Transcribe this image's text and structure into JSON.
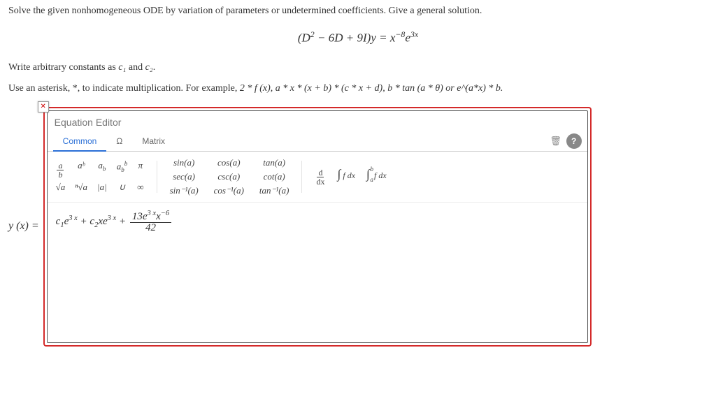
{
  "problem": {
    "line1": "Solve the given nonhomogeneous ODE by variation of parameters or undetermined coefficients. Give a general solution.",
    "display_equation": "(D² − 6D + 9I)y = x⁻⁸e³ˣ",
    "line2_prefix": "Write arbitrary constants as ",
    "const1": "c₁",
    "const_and": " and ",
    "const2": "c₂",
    "line3_prefix": "Use an asterisk, *, to indicate multiplication. For example, ",
    "line3_examples": "2 * f (x), a * x * (x + b) * (c * x + d), b * tan (a * θ) or e^(a*x) * b."
  },
  "lhs": "y (x) =",
  "editor": {
    "title": "Equation Editor",
    "close_glyph": "✕",
    "tabs": {
      "common": "Common",
      "omega": "Ω",
      "matrix": "Matrix"
    },
    "toolbar": {
      "trash_glyph": "🗑",
      "help_glyph": "?"
    },
    "palette": {
      "g1": {
        "frac_a": "a",
        "frac_b": "b",
        "ab": "aᵇ",
        "a_sub": "a_b",
        "a_sub_sup": "aᵇ_b",
        "pi": "π",
        "sqrt": "√a",
        "nroot": "ⁿ√a",
        "abs": "|a|",
        "union": "∪",
        "inf": "∞"
      },
      "trig": {
        "sin": "sin(a)",
        "cos": "cos(a)",
        "tan": "tan(a)",
        "sec": "sec(a)",
        "csc": "csc(a)",
        "cot": "cot(a)",
        "asin": "sin⁻¹(a)",
        "acos": "cos⁻¹(a)",
        "atan": "tan⁻¹(a)"
      },
      "calc": {
        "deriv_num": "d",
        "deriv_den": "dx",
        "int_label": "∫ f dx",
        "defint_b": "b",
        "defint_a": "a"
      }
    },
    "answer": {
      "term1_coeff": "c₁e",
      "term1_exp": "3 x",
      "plus1": " + ",
      "term2_coeff": "c₂xe",
      "term2_exp": "3 x",
      "plus2": " + ",
      "frac_num": "13e³ ˣx⁻⁶",
      "frac_den": "42"
    }
  }
}
